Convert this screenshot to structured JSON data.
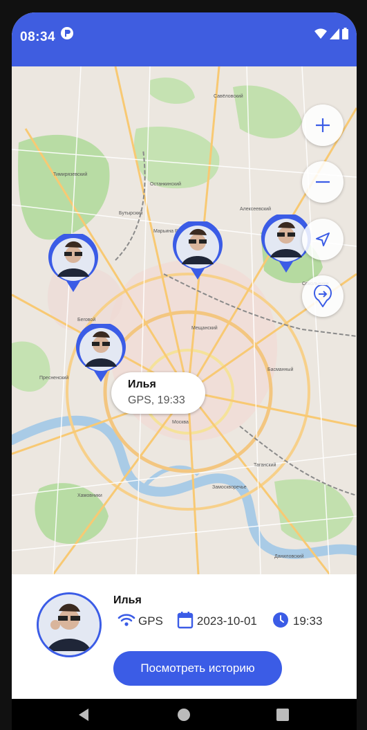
{
  "status_bar": {
    "time": "08:34",
    "app_icon": "app-notification-icon",
    "icons": [
      "wifi-icon",
      "cellular-signal-icon",
      "battery-icon"
    ]
  },
  "map": {
    "controls": [
      "zoom-in-icon",
      "zoom-out-icon",
      "my-location-icon",
      "route-icon"
    ],
    "callout": {
      "name": "Илья",
      "info": "GPS, 19:33"
    },
    "labels": [
      "Москва",
      "Савёловский",
      "Алексеевский",
      "Марьина Роща",
      "Таганский",
      "Замоскворечье",
      "Хамовники",
      "Пресненский",
      "Беговой",
      "Басманный",
      "Сокольники",
      "Даниловский",
      "Мещанский",
      "Останкинский",
      "Бутырский",
      "Тимирязевский"
    ]
  },
  "person": {
    "name": "Илья",
    "source": "GPS",
    "date": "2023-10-01",
    "time": "19:33",
    "history_button": "Посмотреть историю"
  },
  "colors": {
    "accent": "#3b5ce6",
    "status_bar": "#3f5de0"
  }
}
